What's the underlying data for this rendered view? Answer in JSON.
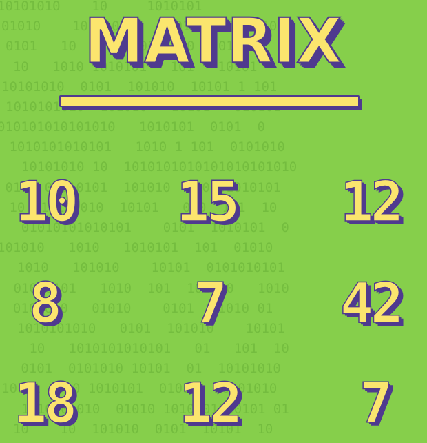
{
  "title": "MATRIX",
  "colors": {
    "background": "#86cf4b",
    "binary_text": "#6fb83b",
    "primary_fill": "#fbe56e",
    "outline_shadow": "#4f3a8f"
  },
  "matrix": {
    "rows": [
      [
        "10",
        "15",
        "12"
      ],
      [
        "8",
        "7",
        "42"
      ],
      [
        "18",
        "12",
        "7"
      ]
    ]
  },
  "background_binary": {
    "lines": [
      "10101010    10     1010101",
      "01010    1010101     101010  101010",
      "0101   10    01010101010   010101",
      "  10   1010 1010101   101   10101",
      "10101010  0101  101010  10101 1 101",
      "1010101010  101010   10101   010101",
      "010101010101010   1010101  0101  0",
      " 1010101010101   1010 1 101  0101010",
      "  10101010 10  1010101010101010101010",
      " 0101 01010101  101010   10101010101",
      " 10  10101010  10101   010  101  10",
      "  01010101010101    0101  1010101  0",
      "101010   1010   1010101  101  01010",
      "  1010   101010    10101  0101010101",
      " 01010101   1010  101  101010   1010",
      "  0101010   01010    0101   1010 01",
      "  1010101010   0101  101010    10101",
      "   10   1010101010101   01   101  10",
      "   0101  0101010 10101  01  10101010",
      "10101 1010 1010101  01010   0101010",
      "  1010101010  01010 1010101010101 01",
      "  10    10  101010  0101  10101  10"
    ]
  }
}
